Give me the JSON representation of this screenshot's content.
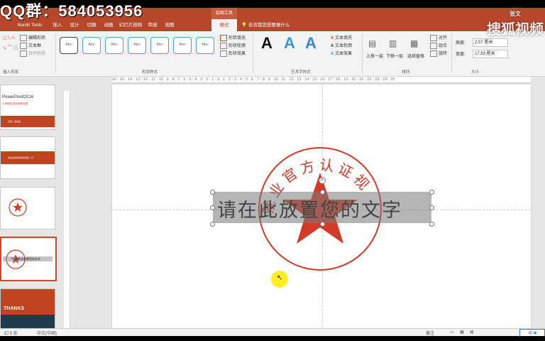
{
  "overlay": {
    "qq_text": "QQ群：584053956",
    "watermark_text": "搜狐视频",
    "watermark_sub": "张文"
  },
  "titlebar": {
    "contextual_tab": "绘图工具"
  },
  "tabs": [
    {
      "label": "Nordri Tools"
    },
    {
      "label": "插入"
    },
    {
      "label": "设计"
    },
    {
      "label": "切换"
    },
    {
      "label": "动画"
    },
    {
      "label": "幻灯片放映"
    },
    {
      "label": "审阅"
    },
    {
      "label": "视图"
    },
    {
      "label": "格式",
      "active": true
    }
  ],
  "tellme": "告诉我您想要做什么",
  "ribbon": {
    "insert_shapes": {
      "label": "插入形状",
      "edit_shape": "编辑形状",
      "text_box": "文本框",
      "merge_shapes": "合并形状"
    },
    "shape_styles": {
      "label": "形状样式",
      "swatch_text": "Abc",
      "fill": "形状填充",
      "outline": "形状轮廓",
      "effects": "形状效果"
    },
    "wordart": {
      "label": "艺术字样式",
      "text_fill": "文本填充",
      "text_outline": "文本轮廓",
      "text_effects": "文本效果",
      "letter": "A"
    },
    "arrange": {
      "label": "排列",
      "bring_forward": "上移一层",
      "send_backward": "下移一层",
      "selection_pane": "选择窗格",
      "align": "对齐",
      "group": "组合",
      "rotate": "旋转"
    },
    "size": {
      "label": "大小",
      "height_label": "高度:",
      "height_value": "2.57 厘米",
      "width_label": "宽度:",
      "width_value": "17.83 厘米"
    }
  },
  "ruler": {
    "ticks": "16 · 15 · 14 · 13 · 12 · 11 · 10 · 9 · 8 · 7 · 6 · 5 · 4 · 3 · 2 · 1 · 0 · 1 · 2 · 3 · 4 · 5 · 6 · 7 · 8 · 9 · 10 · 11 · 12 · 13 · 14 · 15 · 16 · 17 · 18 · 19 · 20 · 21 · 22 · 23 · 24 · 25"
  },
  "thumbnails": [
    {
      "title": "PowerPoint2016",
      "subtitle": "公司网站·就业相关信息",
      "bar_text": "主讲：某某某"
    },
    {
      "bar_text": "请在此添加您的标题在一行"
    },
    {},
    {
      "text": "请在此放置您的文字"
    },
    {
      "text": "THANKS"
    }
  ],
  "slide": {
    "textbox_text": "请在此放置您的文字",
    "seal_text": "就业官方认证视",
    "seal_color": "#d33a27"
  },
  "status": {
    "slide_info": "幻 5 张",
    "language": "中文(中国)",
    "notes": "备注",
    "ime": "中"
  }
}
